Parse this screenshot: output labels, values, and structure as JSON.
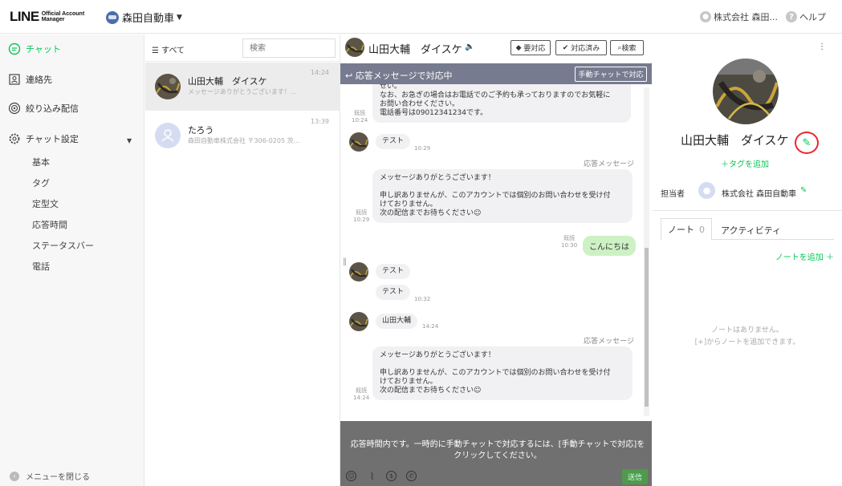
{
  "header": {
    "logo_main": "LINE",
    "logo_sub_1": "Official Account",
    "logo_sub_2": "Manager",
    "account_name": "森田自動車",
    "user_name": "株式会社 森田...",
    "help_label": "ヘルプ"
  },
  "sidebar": {
    "chat": "チャット",
    "contacts": "連絡先",
    "targeted": "絞り込み配信",
    "chat_settings": "チャット設定",
    "sub_items": [
      "基本",
      "タグ",
      "定型文",
      "応答時間",
      "ステータスバー",
      "電話"
    ],
    "close_menu": "メニューを閉じる"
  },
  "list": {
    "filter": "すべて",
    "search_placeholder": "検索",
    "conversations": [
      {
        "name": "山田大輔　ダイスケ",
        "preview": "メッセージありがとうございます！...",
        "time": "14:24"
      },
      {
        "name": "たろう",
        "preview": "森田自動車株式会社 〒306-0205 茨城...",
        "time": "13:39"
      }
    ]
  },
  "chat": {
    "name": "山田大輔　ダイスケ",
    "btn_required": "要対応",
    "btn_done": "対応済み",
    "btn_search": "検索",
    "bar_label": "応答メッセージで対応中",
    "bar_button": "手動チャットで対応",
    "messages": {
      "top_bubble_l1": "せい。",
      "top_bubble_l2": "なお、お急ぎの場合はお電話でのご予約も承っておりますのでお気軽に",
      "top_bubble_l3": "お問い合わせください。",
      "top_bubble_l4": "電話番号は09012341234です。",
      "read": "既読",
      "t1024": "10:24",
      "test": "テスト",
      "t1029": "10:29",
      "auto_label": "応答メッセージ",
      "auto_l1": "メッセージありがとうございます！",
      "auto_l2": "申し訳ありませんが、このアカウントでは個別のお問い合わせを受け付",
      "auto_l3": "けておりません。",
      "auto_l4": "次の配信までお待ちください",
      "hello": "こんにちは",
      "t1030": "10:30",
      "t1032": "10:32",
      "yamada": "山田大輔",
      "t1424": "14:24"
    },
    "composer_text_1": "応答時間内です。一時的に手動チャットで対応するには、[手動チャットで対応]を",
    "composer_text_2": "クリックしてください。",
    "send": "送信"
  },
  "profile": {
    "name": "山田大輔　ダイスケ",
    "add_tag": "＋タグを追加",
    "assignee_label": "担当者",
    "assignee_name": "株式会社 森田自動車",
    "tab_note": "ノート",
    "tab_note_count": "0",
    "tab_activity": "アクティビティ",
    "add_note": "ノートを追加 ＋",
    "empty_1": "ノートはありません。",
    "empty_2": "[+]からノートを追加できます。"
  },
  "colors": {
    "accent": "#06c755",
    "bar": "#767b8f",
    "composer": "#707070",
    "highlight_circle": "#e8262b"
  }
}
